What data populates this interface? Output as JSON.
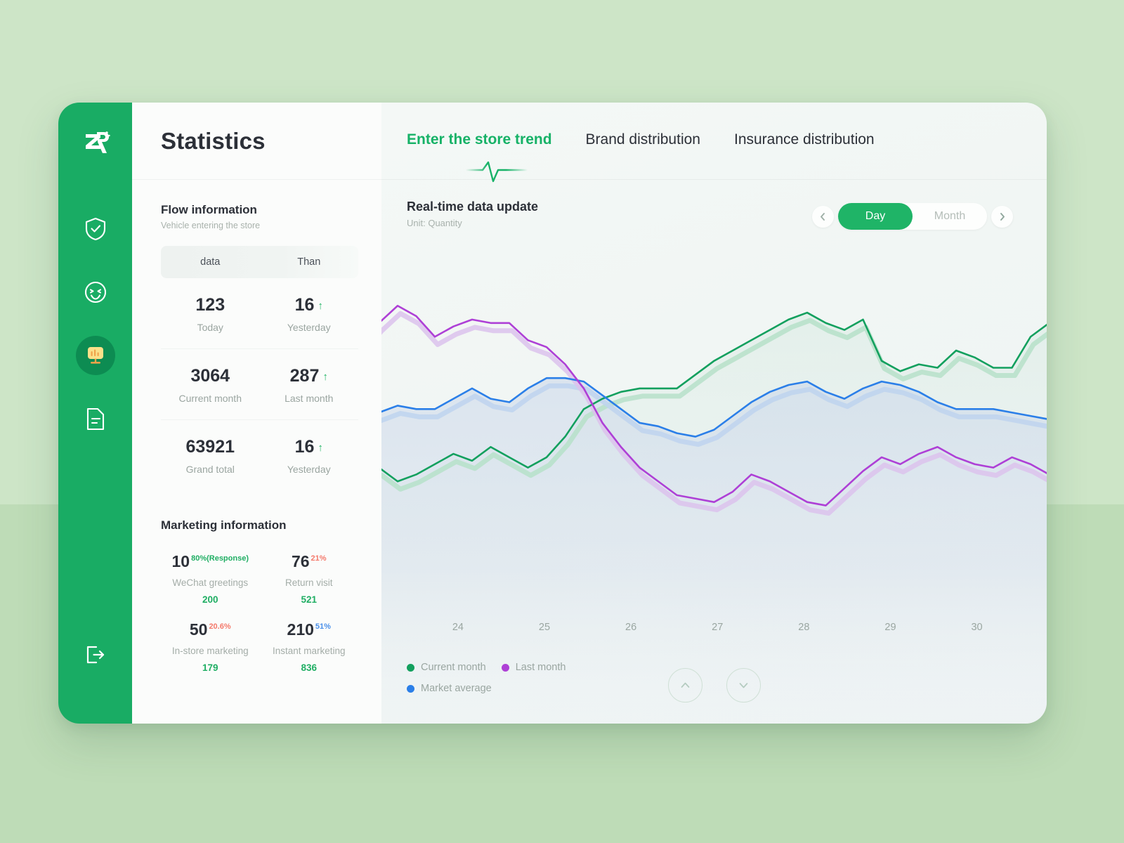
{
  "sidebar": {
    "logo_alt": "ZR",
    "items": [
      {
        "name": "shield-check-icon",
        "label": "Verification"
      },
      {
        "name": "smiley-icon",
        "label": "Customers"
      },
      {
        "name": "monitor-chart-icon",
        "label": "Statistics",
        "active": true
      },
      {
        "name": "document-icon",
        "label": "Reports"
      }
    ],
    "logout_label": "Logout"
  },
  "stats_panel": {
    "title": "Statistics",
    "flow": {
      "title": "Flow information",
      "subtitle": "Vehicle entering the store",
      "columns": [
        "data",
        "Than"
      ],
      "rows": [
        {
          "value": "123",
          "label": "Today",
          "compare": "16",
          "compare_label": "Yesterday",
          "trend": "up"
        },
        {
          "value": "3064",
          "label": "Current month",
          "compare": "287",
          "compare_label": "Last month",
          "trend": "up"
        },
        {
          "value": "63921",
          "label": "Grand total",
          "compare": "16",
          "compare_label": "Yesterday",
          "trend": "up"
        }
      ]
    },
    "marketing": {
      "title": "Marketing information",
      "items": [
        {
          "num": "10",
          "sup": "80%(Response)",
          "sup_color": "#1fae63",
          "label": "WeChat greetings",
          "sub": "200"
        },
        {
          "num": "76",
          "sup": "21%",
          "sup_color": "#f4796b",
          "label": "Return visit",
          "sub": "521"
        },
        {
          "num": "50",
          "sup": "20.6%",
          "sup_color": "#f4796b",
          "label": "In-store marketing",
          "sub": "179"
        },
        {
          "num": "210",
          "sup": "51%",
          "sup_color": "#4a90ea",
          "label": "Instant marketing",
          "sub": "836"
        }
      ]
    }
  },
  "main": {
    "tabs": [
      {
        "label": "Enter the store trend",
        "active": true
      },
      {
        "label": "Brand distribution",
        "active": false
      },
      {
        "label": "Insurance distribution",
        "active": false
      }
    ],
    "subhead": {
      "title": "Real-time data update",
      "unit": "Unit: Quantity"
    },
    "range": {
      "prev_icon": "chevron-left-icon",
      "next_icon": "chevron-right-icon",
      "options": [
        "Day",
        "Month"
      ],
      "selected": "Day"
    },
    "pager": {
      "up_icon": "chevron-up-icon",
      "down_icon": "chevron-down-icon"
    }
  },
  "chart_data": {
    "type": "line",
    "title": "Real-time data update",
    "xlabel": "",
    "ylabel": "Quantity",
    "grid": false,
    "legend_position": "bottom-left",
    "tick_labels": [
      "24",
      "25",
      "26",
      "27",
      "28",
      "29",
      "30"
    ],
    "x": [
      0,
      1,
      2,
      3,
      4,
      5,
      6,
      7,
      8,
      9,
      10,
      11,
      12,
      13,
      14,
      15,
      16,
      17,
      18,
      19,
      20,
      21,
      22,
      23,
      24,
      25,
      26,
      27,
      28,
      29,
      30,
      31,
      32,
      33,
      34,
      35,
      36,
      37,
      38
    ],
    "ylim": [
      0,
      100
    ],
    "colors": {
      "current_month": "#13a05e",
      "last_month": "#ae40d6",
      "market_average": "#2b7fe8"
    },
    "series": [
      {
        "name": "Current month",
        "color": "#13a05e",
        "values": [
          34,
          35,
          31,
          33,
          36,
          39,
          37,
          41,
          38,
          35,
          38,
          44,
          52,
          55,
          57,
          58,
          58,
          58,
          62,
          66,
          69,
          72,
          75,
          78,
          80,
          77,
          75,
          78,
          66,
          63,
          65,
          64,
          69,
          67,
          64,
          64,
          73,
          77,
          75
        ]
      },
      {
        "name": "Last month",
        "color": "#ae40d6",
        "values": [
          71,
          77,
          82,
          79,
          73,
          76,
          78,
          77,
          77,
          72,
          70,
          65,
          58,
          48,
          41,
          35,
          31,
          27,
          26,
          25,
          28,
          33,
          31,
          28,
          25,
          24,
          29,
          34,
          38,
          36,
          39,
          41,
          38,
          36,
          35,
          38,
          36,
          33,
          29
        ]
      },
      {
        "name": "Market average",
        "color": "#2b7fe8",
        "values": [
          49,
          51,
          53,
          52,
          52,
          55,
          58,
          55,
          54,
          58,
          61,
          61,
          60,
          56,
          52,
          48,
          47,
          45,
          44,
          46,
          50,
          54,
          57,
          59,
          60,
          57,
          55,
          58,
          60,
          59,
          57,
          54,
          52,
          52,
          52,
          51,
          50,
          49,
          48
        ]
      }
    ]
  }
}
